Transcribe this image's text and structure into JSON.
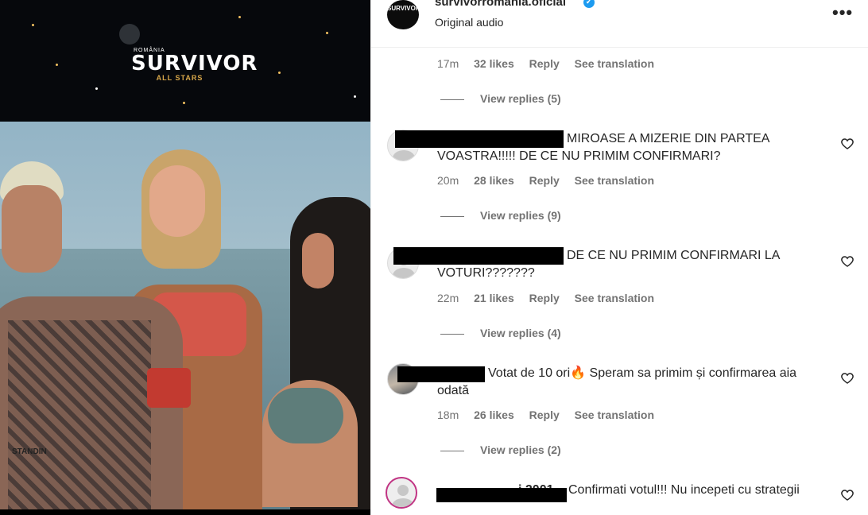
{
  "media": {
    "logo": {
      "top_line": "ROMÂNIA",
      "title": "SURVIVOR",
      "subtitle": "ALL STARS"
    },
    "tattoo_text": "STANDIN"
  },
  "header": {
    "username": "survivorromania.oficial",
    "audio": "Original audio",
    "more_icon": "more-horizontal-icon"
  },
  "comments": [
    {
      "text_line1": "",
      "text_line2": "",
      "time": "17m",
      "likes": "32 likes",
      "reply": "Reply",
      "translation": "See translation",
      "view_replies": "View replies (5)"
    },
    {
      "text_line1": "MIROASE A MIZERIE DIN PARTEA",
      "text_line2": "VOASTRA!!!!! DE CE NU PRIMIM CONFIRMARI?",
      "time": "20m",
      "likes": "28 likes",
      "reply": "Reply",
      "translation": "See translation",
      "view_replies": "View replies (9)"
    },
    {
      "text_line1": "DE CE NU PRIMIM CONFIRMARI LA",
      "text_line2": "VOTURI???????",
      "time": "22m",
      "likes": "21 likes",
      "reply": "Reply",
      "translation": "See translation",
      "view_replies": "View replies (4)"
    },
    {
      "text_line1": "Votat de 10 ori🔥 Speram sa primim și confirmarea aia",
      "text_line2": "odată",
      "time": "18m",
      "likes": "26 likes",
      "reply": "Reply",
      "translation": "See translation",
      "view_replies": "View replies (2)"
    },
    {
      "username_partial": "i 2001",
      "text_line1": "Confirmati votul!!! Nu incepeti cu strategii"
    }
  ],
  "colors": {
    "verified": "#1d9bf0",
    "meta_text": "#737373",
    "primary_text": "#262626"
  }
}
